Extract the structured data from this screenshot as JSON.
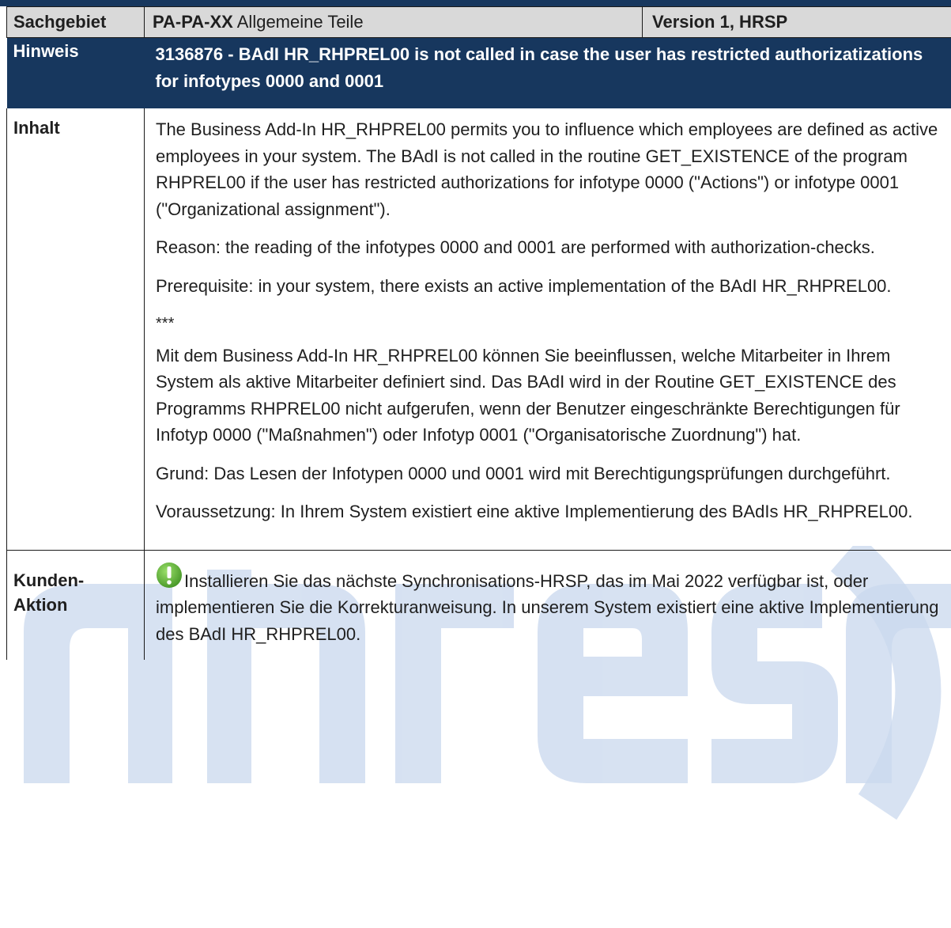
{
  "header": {
    "sachgebiet_label": "Sachgebiet",
    "sachgebiet_code": "PA-PA-XX",
    "sachgebiet_name": " Allgemeine Teile",
    "version": "Version 1, HRSP"
  },
  "hinweis": {
    "label": "Hinweis",
    "title": "3136876 - BAdI HR_RHPREL00 is not called in case the user has restricted authorizatizations for infotypes 0000 and 0001"
  },
  "inhalt": {
    "label": "Inhalt",
    "paragraphs": [
      "The Business Add-In HR_RHPREL00 permits you to influence which employees are defined as active employees in your system. The BAdI is not called in the routine GET_EXISTENCE of the program RHPREL00 if the user has restricted authorizations for infotype 0000 (\"Actions\") or infotype 0001 (\"Organizational assignment\").",
      "Reason: the reading of the infotypes 0000 and 0001 are performed with authorization-checks.",
      "Prerequisite: in your system, there exists an active implementation of the BAdI HR_RHPREL00.",
      "***",
      "Mit dem Business Add-In HR_RHPREL00 können Sie beeinflussen, welche Mitarbeiter in Ihrem System als aktive Mitarbeiter definiert sind. Das BAdI wird in der Routine GET_EXISTENCE des Programms RHPREL00 nicht aufgerufen, wenn der Benutzer eingeschränkte Berechtigungen für Infotyp 0000 (\"Maßnahmen\") oder Infotyp 0001 (\"Organisatorische Zuordnung\") hat.",
      "Grund: Das Lesen der Infotypen 0000 und 0001 wird mit Berechtigungsprüfungen durchgeführt.",
      "Voraussetzung: In Ihrem System existiert eine aktive Implementierung des BAdIs HR_RHPREL00."
    ]
  },
  "kunden": {
    "label_line1": "Kunden-",
    "label_line2": "Aktion",
    "text": "Installieren Sie das nächste Synchronisations-HRSP, das im Mai 2022 verfügbar ist, oder implementieren Sie die Korrekturanweisung. In unserem System existiert eine aktive Implementierung des BAdI HR_RHPREL00."
  },
  "icons": {
    "notice": "exclamation-icon",
    "watermark": "abresa-watermark"
  },
  "colors": {
    "header_bar": "#17375e",
    "label_row_bg": "#d9d9d9",
    "watermark": "#b9cbe6",
    "notice_icon": "#6cb33f"
  }
}
